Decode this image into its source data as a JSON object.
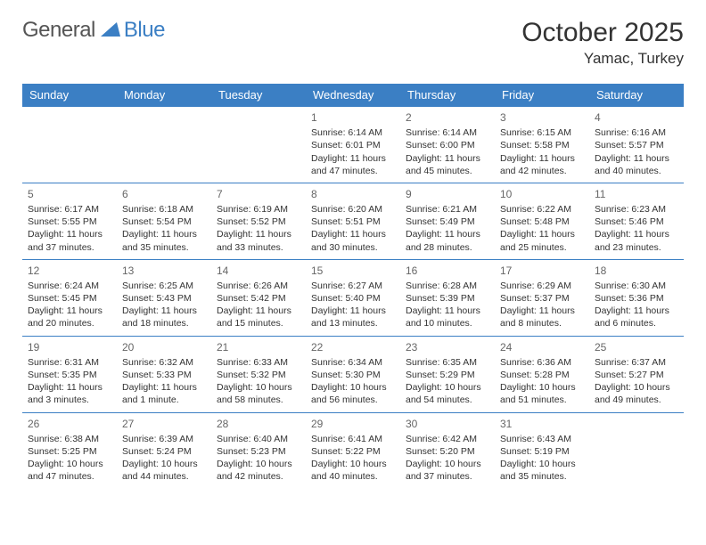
{
  "brand": {
    "general": "General",
    "blue": "Blue"
  },
  "title": "October 2025",
  "location": "Yamac, Turkey",
  "daysOfWeek": [
    "Sunday",
    "Monday",
    "Tuesday",
    "Wednesday",
    "Thursday",
    "Friday",
    "Saturday"
  ],
  "weeks": [
    [
      null,
      null,
      null,
      {
        "num": "1",
        "sunrise": "Sunrise: 6:14 AM",
        "sunset": "Sunset: 6:01 PM",
        "daylight1": "Daylight: 11 hours",
        "daylight2": "and 47 minutes."
      },
      {
        "num": "2",
        "sunrise": "Sunrise: 6:14 AM",
        "sunset": "Sunset: 6:00 PM",
        "daylight1": "Daylight: 11 hours",
        "daylight2": "and 45 minutes."
      },
      {
        "num": "3",
        "sunrise": "Sunrise: 6:15 AM",
        "sunset": "Sunset: 5:58 PM",
        "daylight1": "Daylight: 11 hours",
        "daylight2": "and 42 minutes."
      },
      {
        "num": "4",
        "sunrise": "Sunrise: 6:16 AM",
        "sunset": "Sunset: 5:57 PM",
        "daylight1": "Daylight: 11 hours",
        "daylight2": "and 40 minutes."
      }
    ],
    [
      {
        "num": "5",
        "sunrise": "Sunrise: 6:17 AM",
        "sunset": "Sunset: 5:55 PM",
        "daylight1": "Daylight: 11 hours",
        "daylight2": "and 37 minutes."
      },
      {
        "num": "6",
        "sunrise": "Sunrise: 6:18 AM",
        "sunset": "Sunset: 5:54 PM",
        "daylight1": "Daylight: 11 hours",
        "daylight2": "and 35 minutes."
      },
      {
        "num": "7",
        "sunrise": "Sunrise: 6:19 AM",
        "sunset": "Sunset: 5:52 PM",
        "daylight1": "Daylight: 11 hours",
        "daylight2": "and 33 minutes."
      },
      {
        "num": "8",
        "sunrise": "Sunrise: 6:20 AM",
        "sunset": "Sunset: 5:51 PM",
        "daylight1": "Daylight: 11 hours",
        "daylight2": "and 30 minutes."
      },
      {
        "num": "9",
        "sunrise": "Sunrise: 6:21 AM",
        "sunset": "Sunset: 5:49 PM",
        "daylight1": "Daylight: 11 hours",
        "daylight2": "and 28 minutes."
      },
      {
        "num": "10",
        "sunrise": "Sunrise: 6:22 AM",
        "sunset": "Sunset: 5:48 PM",
        "daylight1": "Daylight: 11 hours",
        "daylight2": "and 25 minutes."
      },
      {
        "num": "11",
        "sunrise": "Sunrise: 6:23 AM",
        "sunset": "Sunset: 5:46 PM",
        "daylight1": "Daylight: 11 hours",
        "daylight2": "and 23 minutes."
      }
    ],
    [
      {
        "num": "12",
        "sunrise": "Sunrise: 6:24 AM",
        "sunset": "Sunset: 5:45 PM",
        "daylight1": "Daylight: 11 hours",
        "daylight2": "and 20 minutes."
      },
      {
        "num": "13",
        "sunrise": "Sunrise: 6:25 AM",
        "sunset": "Sunset: 5:43 PM",
        "daylight1": "Daylight: 11 hours",
        "daylight2": "and 18 minutes."
      },
      {
        "num": "14",
        "sunrise": "Sunrise: 6:26 AM",
        "sunset": "Sunset: 5:42 PM",
        "daylight1": "Daylight: 11 hours",
        "daylight2": "and 15 minutes."
      },
      {
        "num": "15",
        "sunrise": "Sunrise: 6:27 AM",
        "sunset": "Sunset: 5:40 PM",
        "daylight1": "Daylight: 11 hours",
        "daylight2": "and 13 minutes."
      },
      {
        "num": "16",
        "sunrise": "Sunrise: 6:28 AM",
        "sunset": "Sunset: 5:39 PM",
        "daylight1": "Daylight: 11 hours",
        "daylight2": "and 10 minutes."
      },
      {
        "num": "17",
        "sunrise": "Sunrise: 6:29 AM",
        "sunset": "Sunset: 5:37 PM",
        "daylight1": "Daylight: 11 hours",
        "daylight2": "and 8 minutes."
      },
      {
        "num": "18",
        "sunrise": "Sunrise: 6:30 AM",
        "sunset": "Sunset: 5:36 PM",
        "daylight1": "Daylight: 11 hours",
        "daylight2": "and 6 minutes."
      }
    ],
    [
      {
        "num": "19",
        "sunrise": "Sunrise: 6:31 AM",
        "sunset": "Sunset: 5:35 PM",
        "daylight1": "Daylight: 11 hours",
        "daylight2": "and 3 minutes."
      },
      {
        "num": "20",
        "sunrise": "Sunrise: 6:32 AM",
        "sunset": "Sunset: 5:33 PM",
        "daylight1": "Daylight: 11 hours",
        "daylight2": "and 1 minute."
      },
      {
        "num": "21",
        "sunrise": "Sunrise: 6:33 AM",
        "sunset": "Sunset: 5:32 PM",
        "daylight1": "Daylight: 10 hours",
        "daylight2": "and 58 minutes."
      },
      {
        "num": "22",
        "sunrise": "Sunrise: 6:34 AM",
        "sunset": "Sunset: 5:30 PM",
        "daylight1": "Daylight: 10 hours",
        "daylight2": "and 56 minutes."
      },
      {
        "num": "23",
        "sunrise": "Sunrise: 6:35 AM",
        "sunset": "Sunset: 5:29 PM",
        "daylight1": "Daylight: 10 hours",
        "daylight2": "and 54 minutes."
      },
      {
        "num": "24",
        "sunrise": "Sunrise: 6:36 AM",
        "sunset": "Sunset: 5:28 PM",
        "daylight1": "Daylight: 10 hours",
        "daylight2": "and 51 minutes."
      },
      {
        "num": "25",
        "sunrise": "Sunrise: 6:37 AM",
        "sunset": "Sunset: 5:27 PM",
        "daylight1": "Daylight: 10 hours",
        "daylight2": "and 49 minutes."
      }
    ],
    [
      {
        "num": "26",
        "sunrise": "Sunrise: 6:38 AM",
        "sunset": "Sunset: 5:25 PM",
        "daylight1": "Daylight: 10 hours",
        "daylight2": "and 47 minutes."
      },
      {
        "num": "27",
        "sunrise": "Sunrise: 6:39 AM",
        "sunset": "Sunset: 5:24 PM",
        "daylight1": "Daylight: 10 hours",
        "daylight2": "and 44 minutes."
      },
      {
        "num": "28",
        "sunrise": "Sunrise: 6:40 AM",
        "sunset": "Sunset: 5:23 PM",
        "daylight1": "Daylight: 10 hours",
        "daylight2": "and 42 minutes."
      },
      {
        "num": "29",
        "sunrise": "Sunrise: 6:41 AM",
        "sunset": "Sunset: 5:22 PM",
        "daylight1": "Daylight: 10 hours",
        "daylight2": "and 40 minutes."
      },
      {
        "num": "30",
        "sunrise": "Sunrise: 6:42 AM",
        "sunset": "Sunset: 5:20 PM",
        "daylight1": "Daylight: 10 hours",
        "daylight2": "and 37 minutes."
      },
      {
        "num": "31",
        "sunrise": "Sunrise: 6:43 AM",
        "sunset": "Sunset: 5:19 PM",
        "daylight1": "Daylight: 10 hours",
        "daylight2": "and 35 minutes."
      },
      null
    ]
  ]
}
